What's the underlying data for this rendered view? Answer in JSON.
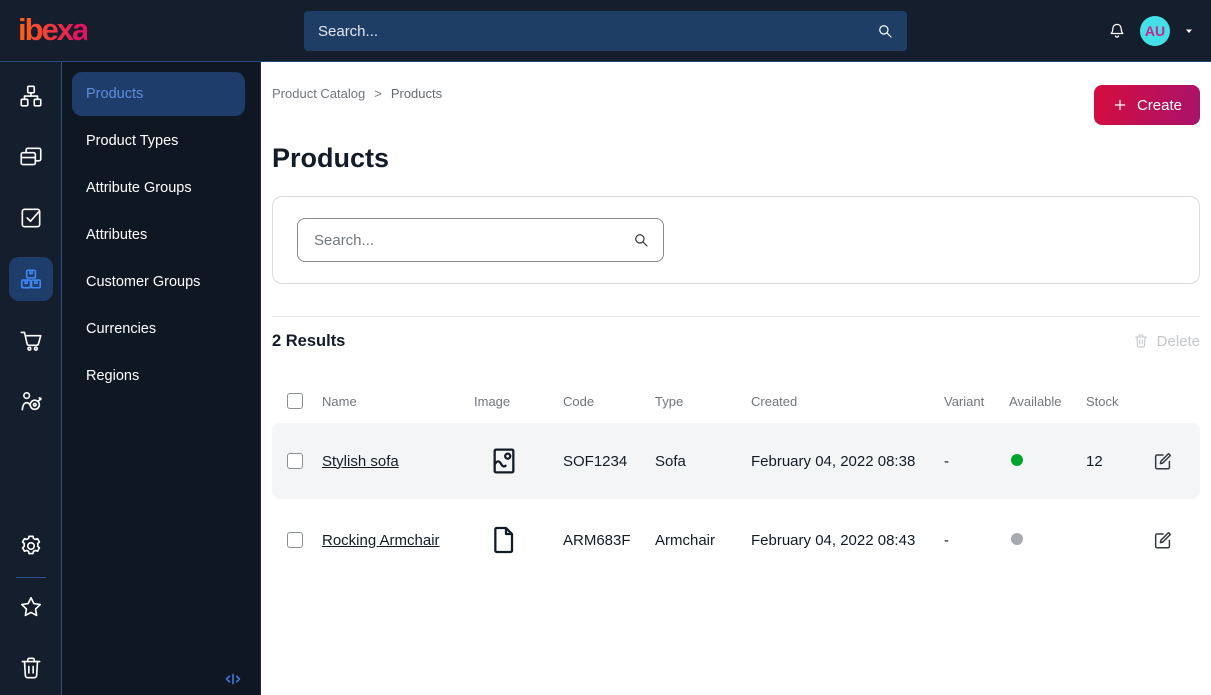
{
  "topbar": {
    "logo": "ibexa",
    "search_placeholder": "Search...",
    "avatar_initials": "AU"
  },
  "icons": {
    "topbar": [
      "search-icon",
      "bell-icon",
      "caret-down-icon"
    ],
    "rail": [
      "content-tree-icon",
      "pages-icon",
      "tasks-icon",
      "product-boxes-icon",
      "cart-icon",
      "personalization-icon",
      "gear-icon",
      "star-icon",
      "trash-icon"
    ],
    "table": [
      "image-icon",
      "file-icon",
      "edit-icon"
    ],
    "misc": [
      "plus-icon",
      "collapse-icon",
      "delete-trash-icon"
    ]
  },
  "sidebar": {
    "items": [
      {
        "label": "Products",
        "active": true
      },
      {
        "label": "Product Types",
        "active": false
      },
      {
        "label": "Attribute Groups",
        "active": false
      },
      {
        "label": "Attributes",
        "active": false
      },
      {
        "label": "Customer Groups",
        "active": false
      },
      {
        "label": "Currencies",
        "active": false
      },
      {
        "label": "Regions",
        "active": false
      }
    ]
  },
  "main": {
    "breadcrumb": {
      "parent": "Product Catalog",
      "separator": ">",
      "current": "Products"
    },
    "create_label": "Create",
    "page_title": "Products",
    "filter_search_placeholder": "Search...",
    "results_label": "2 Results",
    "delete_label": "Delete",
    "table": {
      "headers": [
        "Name",
        "Image",
        "Code",
        "Type",
        "Created",
        "Variant",
        "Available",
        "Stock"
      ],
      "rows": [
        {
          "name": "Stylish sofa",
          "media": "image-icon",
          "code": "SOF1234",
          "type": "Sofa",
          "created": "February 04, 2022 08:38",
          "variant": "-",
          "available": true,
          "stock": "12"
        },
        {
          "name": "Rocking Armchair",
          "media": "file-icon",
          "code": "ARM683F",
          "type": "Armchair",
          "created": "February 04, 2022 08:43",
          "variant": "-",
          "available": false,
          "stock": ""
        }
      ]
    }
  },
  "colors": {
    "topbar_bg": "#151e2c",
    "sidenav_bg": "#0f1723",
    "topbar_search_bg": "#1f3e66",
    "accent_blue": "#3f86f0",
    "active_item_bg": "#1e3d6b",
    "active_item_text": "#5b8dda",
    "brand_gradient_start": "#ff5a1f",
    "brand_gradient_end": "#e41262",
    "button_gradient_start": "#d50d3f",
    "button_gradient_end": "#a8126b",
    "avatar_bg": "#44e0e8",
    "avatar_text": "#cb2390",
    "success_green": "#00a42e",
    "inactive_gray": "#a6a9ae",
    "text_dark": "#131c26",
    "text_muted": "#72777d",
    "border_light": "#d9dce1",
    "row_alt_bg": "#f4f5f6"
  }
}
